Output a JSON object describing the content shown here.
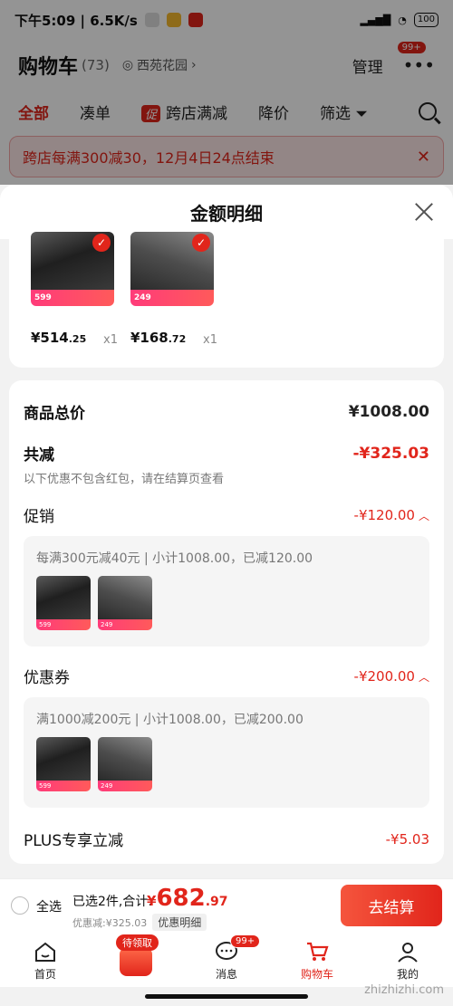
{
  "status_bar": {
    "time_speed": "下午5:09 | 6.5K/s",
    "battery": "100"
  },
  "cart_header": {
    "title": "购物车",
    "count": "(73)",
    "location": "西苑花园",
    "manage": "管理",
    "more_badge": "99+",
    "tabs": [
      "全部",
      "凑单",
      "跨店满减",
      "降价",
      "筛选"
    ],
    "promo_tag": "促",
    "notice": "跨店每满300减30，12月4日24点结束"
  },
  "sheet": {
    "title": "金额明细",
    "items": [
      {
        "price_int": "¥514",
        "price_dec": ".25",
        "qty": "x1",
        "strip": "599"
      },
      {
        "price_int": "¥168",
        "price_dec": ".72",
        "qty": "x1",
        "strip": "249"
      }
    ],
    "subtotal_label": "商品总价",
    "subtotal_value": "¥1008.00",
    "discount_label": "共减",
    "discount_value": "-¥325.03",
    "discount_note": "以下优惠不包含红包，请在结算页查看",
    "promo_label": "促销",
    "promo_value": "-¥120.00",
    "promo_desc": "每满300元减40元 | 小计1008.00，已减120.00",
    "coupon_label": "优惠券",
    "coupon_value": "-¥200.00",
    "coupon_desc": "满1000减200元 | 小计1008.00，已减200.00",
    "plus_label": "PLUS专享立减",
    "plus_value": "-¥5.03"
  },
  "checkout": {
    "select_all": "全选",
    "selected_info": "已选2件,合计:",
    "currency": "¥",
    "total_int": "682",
    "total_dec": ".97",
    "discount_line": "优惠减:¥325.03",
    "detail_btn": "优惠明细",
    "pay_btn": "去结算"
  },
  "tabbar": {
    "items": [
      "首页",
      "",
      "消息",
      "购物车",
      "我的"
    ],
    "pending_badge": "待领取",
    "msg_badge": "99+"
  },
  "watermark": "zhizhizhi.com"
}
